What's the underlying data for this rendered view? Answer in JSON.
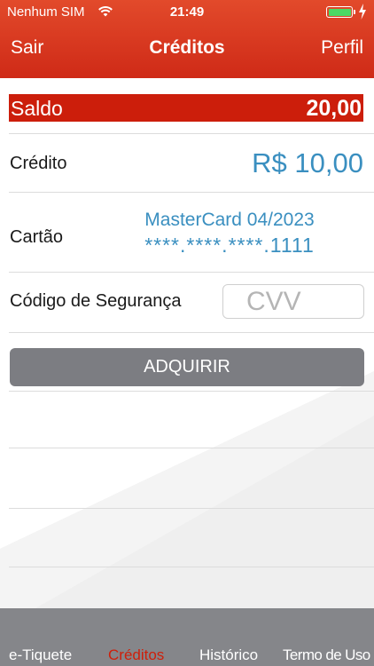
{
  "statusbar": {
    "carrier": "Nenhum SIM",
    "time": "21:49"
  },
  "navbar": {
    "left_button": "Sair",
    "title": "Créditos",
    "right_button": "Perfil"
  },
  "balance": {
    "label": "Saldo",
    "value": "20,00"
  },
  "credit": {
    "label": "Crédito",
    "value": "R$ 10,00"
  },
  "card": {
    "label": "Cartão",
    "name": "MasterCard 04/2023",
    "number": "****.****.****.1111"
  },
  "security": {
    "label": "Código de Segurança",
    "placeholder": "CVV"
  },
  "purchase_button": "ADQUIRIR",
  "tabs": [
    {
      "label": "e-Tiquete",
      "active": false
    },
    {
      "label": "Créditos",
      "active": true
    },
    {
      "label": "Histórico",
      "active": false
    },
    {
      "label": "Termo de Uso",
      "active": false
    }
  ],
  "colors": {
    "header": "#cf2a17",
    "balance_bar": "#cc1e0b",
    "value_text": "#3a8fc0",
    "button": "#7c7d82",
    "tabbar": "#85868a",
    "active_tab": "#cf1f0a"
  }
}
